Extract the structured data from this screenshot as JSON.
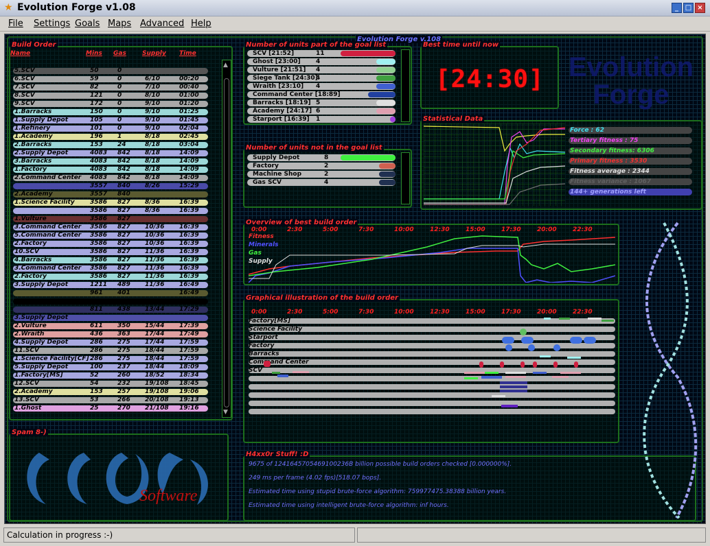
{
  "window": {
    "title": "Evolution Forge v1.08"
  },
  "menu": [
    "File",
    "Settings",
    "Goals",
    "Maps",
    "Advanced",
    "Help"
  ],
  "banner": "Evolution Forge v.108",
  "build_order": {
    "title": "Build Order",
    "headers": [
      "Name",
      "Mins",
      "Gas",
      "Supply",
      "Time"
    ],
    "rows": [
      {
        "name": "5.SCV",
        "mins": "50",
        "gas": "0",
        "supply": "",
        "time": "",
        "color": "#555555"
      },
      {
        "name": "6.SCV",
        "mins": "59",
        "gas": "0",
        "supply": "6/10",
        "time": "00:20",
        "color": "#a8a8a8"
      },
      {
        "name": "7.SCV",
        "mins": "82",
        "gas": "0",
        "supply": "7/10",
        "time": "00:40",
        "color": "#a8a8a8"
      },
      {
        "name": "8.SCV",
        "mins": "121",
        "gas": "0",
        "supply": "8/10",
        "time": "01:00",
        "color": "#a8a8a8"
      },
      {
        "name": "9.SCV",
        "mins": "172",
        "gas": "0",
        "supply": "9/10",
        "time": "01:20",
        "color": "#a8a8a8"
      },
      {
        "name": "1.Barracks",
        "mins": "150",
        "gas": "0",
        "supply": "9/10",
        "time": "01:25",
        "color": "#9cd8d8"
      },
      {
        "name": "1.Supply Depot",
        "mins": "105",
        "gas": "0",
        "supply": "9/10",
        "time": "01:45",
        "color": "#a8a8e0"
      },
      {
        "name": "1.Refinery",
        "mins": "101",
        "gas": "0",
        "supply": "9/10",
        "time": "02:04",
        "color": "#a8a8e0"
      },
      {
        "name": "1.Academy",
        "mins": "196",
        "gas": "1",
        "supply": "8/18",
        "time": "02:45",
        "color": "#e0e0a0"
      },
      {
        "name": "2.Barracks",
        "mins": "153",
        "gas": "24",
        "supply": "8/18",
        "time": "03:04",
        "color": "#9cd8d8"
      },
      {
        "name": "2.Supply Depot",
        "mins": "4083",
        "gas": "842",
        "supply": "8/18",
        "time": "14:09",
        "color": "#a8a8e0"
      },
      {
        "name": "3.Barracks",
        "mins": "4083",
        "gas": "842",
        "supply": "8/18",
        "time": "14:09",
        "color": "#9cd8d8"
      },
      {
        "name": "1.Factory",
        "mins": "4083",
        "gas": "842",
        "supply": "8/18",
        "time": "14:09",
        "color": "#9cd8d8"
      },
      {
        "name": "2.Command Center",
        "mins": "4083",
        "gas": "842",
        "supply": "8/18",
        "time": "14:09",
        "color": "#a8a8a8"
      },
      {
        "name": "",
        "mins": "3557",
        "gas": "840",
        "supply": "8/26",
        "time": "15:29",
        "color": "#4a4aa8"
      },
      {
        "name": "2.Academy",
        "mins": "3557",
        "gas": "840",
        "supply": "",
        "time": "",
        "color": "#5a5a30"
      },
      {
        "name": "1.Science Facility",
        "mins": "3586",
        "gas": "827",
        "supply": "8/36",
        "time": "16:39",
        "color": "#e0e0a0"
      },
      {
        "name": "",
        "mins": "3586",
        "gas": "827",
        "supply": "8/36",
        "time": "16:39",
        "color": "#a8a8e0"
      },
      {
        "name": "1.Vulture",
        "mins": "3586",
        "gas": "827",
        "supply": "",
        "time": "",
        "color": "#6a3030"
      },
      {
        "name": "3.Command Center",
        "mins": "3586",
        "gas": "827",
        "supply": "10/36",
        "time": "16:39",
        "color": "#a8a8e0"
      },
      {
        "name": "5.Command Center",
        "mins": "3586",
        "gas": "827",
        "supply": "10/36",
        "time": "16:39",
        "color": "#a8a8e0"
      },
      {
        "name": "2.Factory",
        "mins": "3586",
        "gas": "827",
        "supply": "10/36",
        "time": "16:39",
        "color": "#a8a8e0"
      },
      {
        "name": "10.SCV",
        "mins": "3586",
        "gas": "827",
        "supply": "11/36",
        "time": "16:39",
        "color": "#a8a8e0"
      },
      {
        "name": "4.Barracks",
        "mins": "3586",
        "gas": "827",
        "supply": "11/36",
        "time": "16:39",
        "color": "#9cd8d8"
      },
      {
        "name": "3.Command Center",
        "mins": "3586",
        "gas": "827",
        "supply": "11/36",
        "time": "16:39",
        "color": "#a8a8e0"
      },
      {
        "name": "2.Factory",
        "mins": "3586",
        "gas": "827",
        "supply": "11/36",
        "time": "16:39",
        "color": "#9cd8d8"
      },
      {
        "name": "3.Supply Depot",
        "mins": "1211",
        "gas": "489",
        "supply": "11/36",
        "time": "16:49",
        "color": "#a8a8e0"
      },
      {
        "name": "",
        "mins": "961",
        "gas": "401",
        "supply": "",
        "time": "16:49",
        "color": "#5a5a30"
      },
      {
        "name": "",
        "mins": "",
        "gas": "",
        "supply": "",
        "time": "",
        "color": "#000000"
      },
      {
        "name": "",
        "mins": "811",
        "gas": "438",
        "supply": "13/44",
        "time": "17:29",
        "color": "#303060"
      },
      {
        "name": "3.Supply Depot",
        "mins": "",
        "gas": "",
        "supply": "",
        "time": "",
        "color": "#5050a8"
      },
      {
        "name": "2.Vulture",
        "mins": "611",
        "gas": "350",
        "supply": "15/44",
        "time": "17:39",
        "color": "#e0a0a0"
      },
      {
        "name": "2.Wraith",
        "mins": "436",
        "gas": "363",
        "supply": "17/44",
        "time": "17:49",
        "color": "#e0a0a0"
      },
      {
        "name": "4.Supply Depot",
        "mins": "286",
        "gas": "275",
        "supply": "17/44",
        "time": "17:59",
        "color": "#a8a8e0"
      },
      {
        "name": "11.SCV",
        "mins": "286",
        "gas": "275",
        "supply": "18/44",
        "time": "17:59",
        "color": "#a8a8a8"
      },
      {
        "name": "1.Science Facility[CF]",
        "mins": "286",
        "gas": "275",
        "supply": "18/44",
        "time": "17:59",
        "color": "#a8a8e0"
      },
      {
        "name": "5.Supply Depot",
        "mins": "100",
        "gas": "237",
        "supply": "18/44",
        "time": "18:09",
        "color": "#a8a8e0"
      },
      {
        "name": "1.Factory[MS]",
        "mins": "52",
        "gas": "260",
        "supply": "18/52",
        "time": "18:34",
        "color": "#a8a8e0"
      },
      {
        "name": "12.SCV",
        "mins": "54",
        "gas": "232",
        "supply": "19/108",
        "time": "18:45",
        "color": "#a8a8a8"
      },
      {
        "name": "2.Academy",
        "mins": "153",
        "gas": "257",
        "supply": "19/108",
        "time": "19:06",
        "color": "#e0e0a0"
      },
      {
        "name": "13.SCV",
        "mins": "53",
        "gas": "266",
        "supply": "20/108",
        "time": "19:13",
        "color": "#a8a8a8"
      },
      {
        "name": "1.Ghost",
        "mins": "25",
        "gas": "270",
        "supply": "21/108",
        "time": "19:16",
        "color": "#e0a0e0"
      }
    ]
  },
  "goal_list": {
    "title": "Number of units part of the goal list",
    "items": [
      {
        "name": "SCV [21:52]",
        "count": "11",
        "color": "#d02040"
      },
      {
        "name": "Ghost [23:00]",
        "count": "4",
        "color": "#a0f0f0"
      },
      {
        "name": "Vulture [21:51]",
        "count": "4",
        "color": "#90d090"
      },
      {
        "name": "Siege Tank [24:30]",
        "count": "4",
        "color": "#40a040"
      },
      {
        "name": "Wraith [23:10]",
        "count": "4",
        "color": "#4060d0"
      },
      {
        "name": "Command Center [18:89]",
        "count": "",
        "color": "#2040a0"
      },
      {
        "name": "Barracks [18:19]",
        "count": "5",
        "color": "#e0e0e0"
      },
      {
        "name": "Academy [24:17]",
        "count": "6",
        "color": "#e0a0b0"
      },
      {
        "name": "Starport [16:39]",
        "count": "1",
        "color": "#a040e0"
      }
    ]
  },
  "non_goal": {
    "title": "Number of units not in the goal list",
    "items": [
      {
        "name": "Supply Depot",
        "count": "8",
        "color": "#40f040"
      },
      {
        "name": "Factory",
        "count": "2",
        "color": "#d06050"
      },
      {
        "name": "Machine Shop",
        "count": "2",
        "color": "#203050"
      },
      {
        "name": "Gas SCV",
        "count": "4",
        "color": "#203050"
      }
    ]
  },
  "best_time": {
    "title": "Best time until now",
    "value": "[24:30]"
  },
  "logo_text": "Evolution Forge",
  "stats": {
    "title": "Statistical Data",
    "items": [
      {
        "label": "Force : 62",
        "color": "#40e0f0",
        "fill": "#444"
      },
      {
        "label": "Tertiary fitness : 75",
        "color": "#f040f0",
        "fill": "#444"
      },
      {
        "label": "Secondary fitness: 6306",
        "color": "#40f040",
        "fill": "#444"
      },
      {
        "label": "Primary fitness : 3530",
        "color": "#f03030",
        "fill": "#444"
      },
      {
        "label": "Fitness average : 2344",
        "color": "#e0e0e0",
        "fill": "#444"
      },
      {
        "label": "Fitness variance : 1067",
        "color": "#606060",
        "fill": "#444"
      },
      {
        "label": "144+ generations left",
        "color": "#a0a0ff",
        "fill": "#4040b0"
      }
    ]
  },
  "overview": {
    "title": "Overview of best build order",
    "ticks": [
      "0:00",
      "2:30",
      "5:00",
      "7:30",
      "10:00",
      "12:30",
      "15:00",
      "17:30",
      "20:00",
      "22:30"
    ],
    "legend": [
      {
        "label": "Fitness",
        "color": "#ff3030"
      },
      {
        "label": "Minerals",
        "color": "#5050ff"
      },
      {
        "label": "Gas",
        "color": "#40f040"
      },
      {
        "label": "Supply",
        "color": "#e0e0e0"
      }
    ]
  },
  "graphical": {
    "title": "Graphical illustration of the build order",
    "ticks": [
      "0:00",
      "2:30",
      "5:00",
      "7:30",
      "10:00",
      "12:30",
      "15:00",
      "17:30",
      "20:00",
      "22:30"
    ],
    "lanes": [
      "Factory[MS]",
      "Science Facility",
      "Starport",
      "Factory",
      "Barracks",
      "Command Center",
      "SCV",
      "",
      "",
      "",
      "",
      ""
    ]
  },
  "spam": {
    "title": "Spam 8-)",
    "logo_word": "Software"
  },
  "h4x": {
    "title": "H4xx0r Stuff! :D",
    "lines": [
      "9675 of 1241645705469100236B billion possible build orders checked [0.000000%].",
      "249 ms per frame (4.02 fps)[518.07 bops].",
      "Estimated time using stupid brute-force algorithm: 759977475.38388 billion years.",
      "Estimated time using intelligent brute-force algorithm: inf hours."
    ]
  },
  "status": {
    "text": "Calculation in progress :-)"
  }
}
